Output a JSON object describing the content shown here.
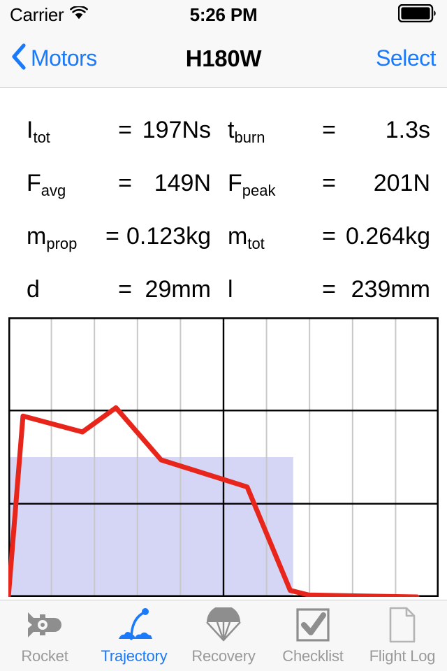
{
  "status_bar": {
    "carrier": "Carrier",
    "wifi_icon": "wifi-icon",
    "time": "5:26 PM",
    "battery_icon": "battery-full-icon"
  },
  "nav_bar": {
    "back_icon": "chevron-left-icon",
    "back_label": "Motors",
    "title": "H180W",
    "action_label": "Select"
  },
  "specs": {
    "rows": [
      {
        "left": {
          "symbol": "I",
          "sub": "tot",
          "eq": "=",
          "value": "197Ns"
        },
        "right": {
          "symbol": "t",
          "sub": "burn",
          "eq": "=",
          "value": "1.3s"
        }
      },
      {
        "left": {
          "symbol": "F",
          "sub": "avg",
          "eq": "=",
          "value": "149N"
        },
        "right": {
          "symbol": "F",
          "sub": "peak",
          "eq": "=",
          "value": "201N"
        }
      },
      {
        "left": {
          "symbol": "m",
          "sub": "prop",
          "eq": "=",
          "value": "0.123kg"
        },
        "right": {
          "symbol": "m",
          "sub": "tot",
          "eq": "=",
          "value": "0.264kg"
        }
      },
      {
        "left": {
          "symbol": "d",
          "sub": "",
          "eq": "=",
          "value": "29mm"
        },
        "right": {
          "symbol": "l",
          "sub": "",
          "eq": "=",
          "value": "239mm"
        }
      }
    ]
  },
  "chart_data": {
    "type": "line",
    "title": "",
    "xlabel": "",
    "ylabel": "",
    "grid": true,
    "legend": "none",
    "curve_color": "#e8251a",
    "shaded_region_color": "#d5d5f5",
    "axis_color": "#000000",
    "gridline_color": "#c8c8c8",
    "xlim": [
      0,
      10
    ],
    "ylim": [
      0,
      3
    ],
    "x_gridlines": [
      1,
      2,
      3,
      4,
      5,
      6,
      7,
      8,
      9
    ],
    "x_major_gridlines": [
      5
    ],
    "y_major_gridlines": [
      1,
      2
    ],
    "series": [
      {
        "name": "thrust",
        "points": [
          [
            0.0,
            0.0
          ],
          [
            0.34,
            1.94
          ],
          [
            1.72,
            1.77
          ],
          [
            2.5,
            2.03
          ],
          [
            3.55,
            1.47
          ],
          [
            5.0,
            1.26
          ],
          [
            5.55,
            1.18
          ],
          [
            6.55,
            0.07
          ],
          [
            6.98,
            0.02
          ],
          [
            9.5,
            0.0
          ]
        ]
      }
    ],
    "shaded_region": {
      "x0": 0,
      "x1": 6.62,
      "y0": 0,
      "y1": 1.5
    }
  },
  "tab_bar": {
    "tabs": [
      {
        "label": "Rocket",
        "icon": "rocket-icon",
        "active": false
      },
      {
        "label": "Trajectory",
        "icon": "trajectory-icon",
        "active": true
      },
      {
        "label": "Recovery",
        "icon": "parachute-icon",
        "active": false
      },
      {
        "label": "Checklist",
        "icon": "checkbox-check-icon",
        "active": false
      },
      {
        "label": "Flight Log",
        "icon": "document-icon",
        "active": false
      }
    ]
  }
}
